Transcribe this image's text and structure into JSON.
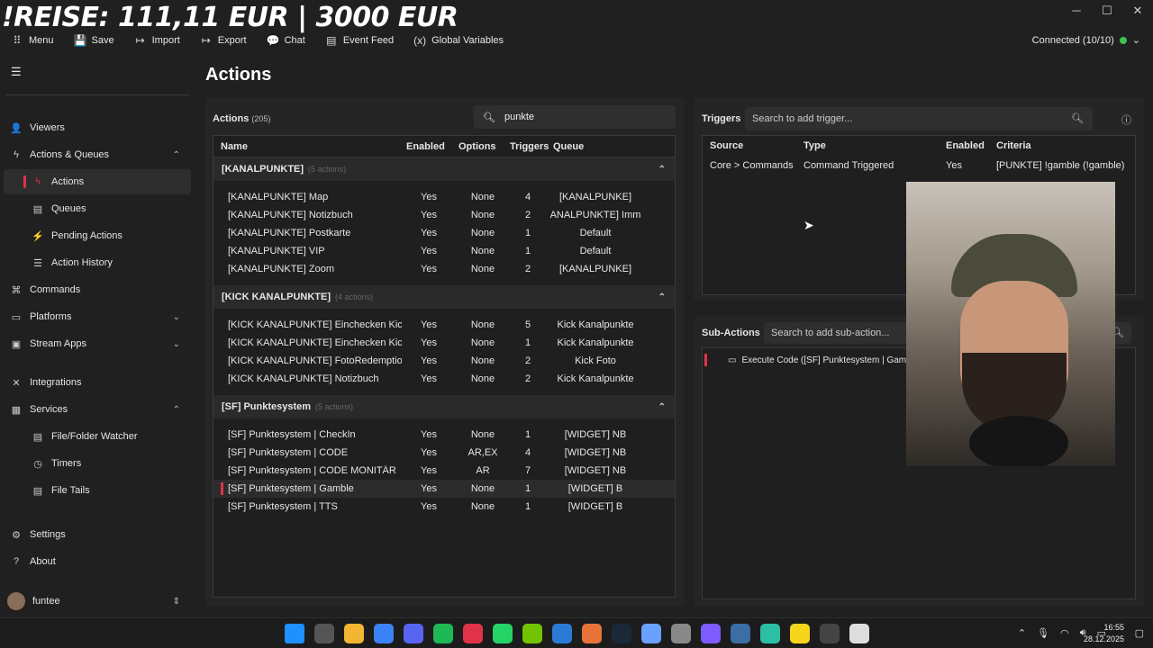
{
  "overlay_title": "!REISE: 111,11 EUR | 3000 EUR",
  "window_controls": [
    "─",
    "☐",
    "✕"
  ],
  "toolbar": {
    "items": [
      {
        "label": "Menu",
        "icon": "grid-icon",
        "glyph": "⠿"
      },
      {
        "label": "Save",
        "icon": "save-icon",
        "glyph": "💾"
      },
      {
        "label": "Import",
        "icon": "import-icon",
        "glyph": "↦"
      },
      {
        "label": "Export",
        "icon": "export-icon",
        "glyph": "↦"
      },
      {
        "label": "Chat",
        "icon": "chat-icon",
        "glyph": "💬"
      },
      {
        "label": "Event Feed",
        "icon": "event-feed-icon",
        "glyph": "▤"
      },
      {
        "label": "Global Variables",
        "icon": "variables-icon",
        "glyph": "(x)"
      }
    ],
    "connection": "Connected (10/10)",
    "connection_color": "#3ec24b"
  },
  "sidebar": {
    "items": [
      {
        "label": "Viewers",
        "icon": "viewers-icon",
        "glyph": "👤",
        "indent": false,
        "chevron": "",
        "active": false
      },
      {
        "label": "Actions & Queues",
        "icon": "lightning-icon",
        "glyph": "ϟ",
        "indent": false,
        "chevron": "⌃",
        "active": false
      },
      {
        "label": "Actions",
        "icon": "lightning-icon",
        "glyph": "ϟ",
        "indent": true,
        "chevron": "",
        "active": true
      },
      {
        "label": "Queues",
        "icon": "queue-icon",
        "glyph": "▤",
        "indent": true,
        "chevron": "",
        "active": false
      },
      {
        "label": "Pending Actions",
        "icon": "pending-icon",
        "glyph": "⚡",
        "indent": true,
        "chevron": "",
        "active": false
      },
      {
        "label": "Action History",
        "icon": "history-icon",
        "glyph": "☰",
        "indent": true,
        "chevron": "",
        "active": false
      },
      {
        "label": "Commands",
        "icon": "command-icon",
        "glyph": "⌘",
        "indent": false,
        "chevron": "",
        "active": false
      },
      {
        "label": "Platforms",
        "icon": "platforms-icon",
        "glyph": "▭",
        "indent": false,
        "chevron": "⌄",
        "active": false
      },
      {
        "label": "Stream Apps",
        "icon": "stream-apps-icon",
        "glyph": "▣",
        "indent": false,
        "chevron": "⌄",
        "active": false
      },
      {
        "label": "Integrations",
        "icon": "integrations-icon",
        "glyph": "✕",
        "indent": false,
        "chevron": "",
        "active": false
      },
      {
        "label": "Services",
        "icon": "services-icon",
        "glyph": "▦",
        "indent": false,
        "chevron": "⌃",
        "active": false
      },
      {
        "label": "File/Folder Watcher",
        "icon": "file-watcher-icon",
        "glyph": "▤",
        "indent": true,
        "chevron": "",
        "active": false
      },
      {
        "label": "Timers",
        "icon": "timer-icon",
        "glyph": "◷",
        "indent": true,
        "chevron": "",
        "active": false
      },
      {
        "label": "File Tails",
        "icon": "file-tails-icon",
        "glyph": "▤",
        "indent": true,
        "chevron": "",
        "active": false
      },
      {
        "label": "Settings",
        "icon": "gear-icon",
        "glyph": "⚙",
        "indent": false,
        "chevron": "",
        "active": false
      },
      {
        "label": "About",
        "icon": "help-icon",
        "glyph": "?",
        "indent": false,
        "chevron": "",
        "active": false
      }
    ],
    "user": "funtee"
  },
  "page_title": "Actions",
  "actions": {
    "title": "Actions",
    "count": "(205)",
    "search_value": "punkte",
    "columns": [
      "Name",
      "Enabled",
      "Options",
      "Triggers",
      "Queue"
    ],
    "groups": [
      {
        "name": "[KANALPUNKTE]",
        "sub": "(5 actions)",
        "rows": [
          {
            "name": "[KANALPUNKTE] Map",
            "enabled": "Yes",
            "options": "None",
            "triggers": "4",
            "queue": "[KANALPUNKE]",
            "selected": false
          },
          {
            "name": "[KANALPUNKTE] Notizbuch",
            "enabled": "Yes",
            "options": "None",
            "triggers": "2",
            "queue": "ANALPUNKTE] Imm",
            "selected": false
          },
          {
            "name": "[KANALPUNKTE] Postkarte",
            "enabled": "Yes",
            "options": "None",
            "triggers": "1",
            "queue": "Default",
            "selected": false
          },
          {
            "name": "[KANALPUNKTE] VIP",
            "enabled": "Yes",
            "options": "None",
            "triggers": "1",
            "queue": "Default",
            "selected": false
          },
          {
            "name": "[KANALPUNKTE] Zoom",
            "enabled": "Yes",
            "options": "None",
            "triggers": "2",
            "queue": "[KANALPUNKE]",
            "selected": false
          }
        ]
      },
      {
        "name": "[KICK KANALPUNKTE]",
        "sub": "(4 actions)",
        "rows": [
          {
            "name": "[KICK KANALPUNKTE] Einchecken Kick",
            "enabled": "Yes",
            "options": "None",
            "triggers": "5",
            "queue": "Kick Kanalpunkte",
            "selected": false
          },
          {
            "name": "[KICK KANALPUNKTE] Einchecken Kick Add",
            "enabled": "Yes",
            "options": "None",
            "triggers": "1",
            "queue": "Kick Kanalpunkte",
            "selected": false
          },
          {
            "name": "[KICK KANALPUNKTE] FotoRedemption",
            "enabled": "Yes",
            "options": "None",
            "triggers": "2",
            "queue": "Kick Foto",
            "selected": false
          },
          {
            "name": "[KICK KANALPUNKTE] Notizbuch",
            "enabled": "Yes",
            "options": "None",
            "triggers": "2",
            "queue": "Kick Kanalpunkte",
            "selected": false
          }
        ]
      },
      {
        "name": "[SF] Punktesystem",
        "sub": "(5 actions)",
        "rows": [
          {
            "name": "[SF] Punktesystem | CheckIn",
            "enabled": "Yes",
            "options": "None",
            "triggers": "1",
            "queue": "[WIDGET] NB",
            "selected": false
          },
          {
            "name": "[SF] Punktesystem | CODE",
            "enabled": "Yes",
            "options": "AR,EX",
            "triggers": "4",
            "queue": "[WIDGET] NB",
            "selected": false
          },
          {
            "name": "[SF] Punktesystem | CODE MONITÄR",
            "enabled": "Yes",
            "options": "AR",
            "triggers": "7",
            "queue": "[WIDGET] NB",
            "selected": false
          },
          {
            "name": "[SF] Punktesystem | Gamble",
            "enabled": "Yes",
            "options": "None",
            "triggers": "1",
            "queue": "[WIDGET] B",
            "selected": true
          },
          {
            "name": "[SF] Punktesystem | TTS",
            "enabled": "Yes",
            "options": "None",
            "triggers": "1",
            "queue": "[WIDGET] B",
            "selected": false
          }
        ]
      }
    ]
  },
  "triggers": {
    "title": "Triggers",
    "search_placeholder": "Search to add trigger...",
    "columns": [
      "Source",
      "Type",
      "Enabled",
      "Criteria"
    ],
    "rows": [
      {
        "source": "Core > Commands",
        "type": "Command Triggered",
        "enabled": "Yes",
        "criteria": "[PUNKTE] !gamble (!gamble)"
      }
    ]
  },
  "sub_actions": {
    "title": "Sub-Actions",
    "search_placeholder": "Search to add sub-action...",
    "items": [
      {
        "label": "Execute Code ([SF] Punktesystem | Gamble"
      }
    ]
  },
  "taskbar": {
    "icon_colors": [
      "#1e90ff",
      "#555555",
      "#f2b632",
      "#3b82f6",
      "#5865f2",
      "#1db954",
      "#e0334a",
      "#25d366",
      "#73c400",
      "#2b7bd6",
      "#e8733a",
      "#1b2838",
      "#6aa0ff",
      "#888888",
      "#7c5cff",
      "#3a6ea5",
      "#2bbfa4",
      "#f7d51d",
      "#444444",
      "#dddddd"
    ],
    "time": "16:55",
    "date": "28.12.2025"
  }
}
